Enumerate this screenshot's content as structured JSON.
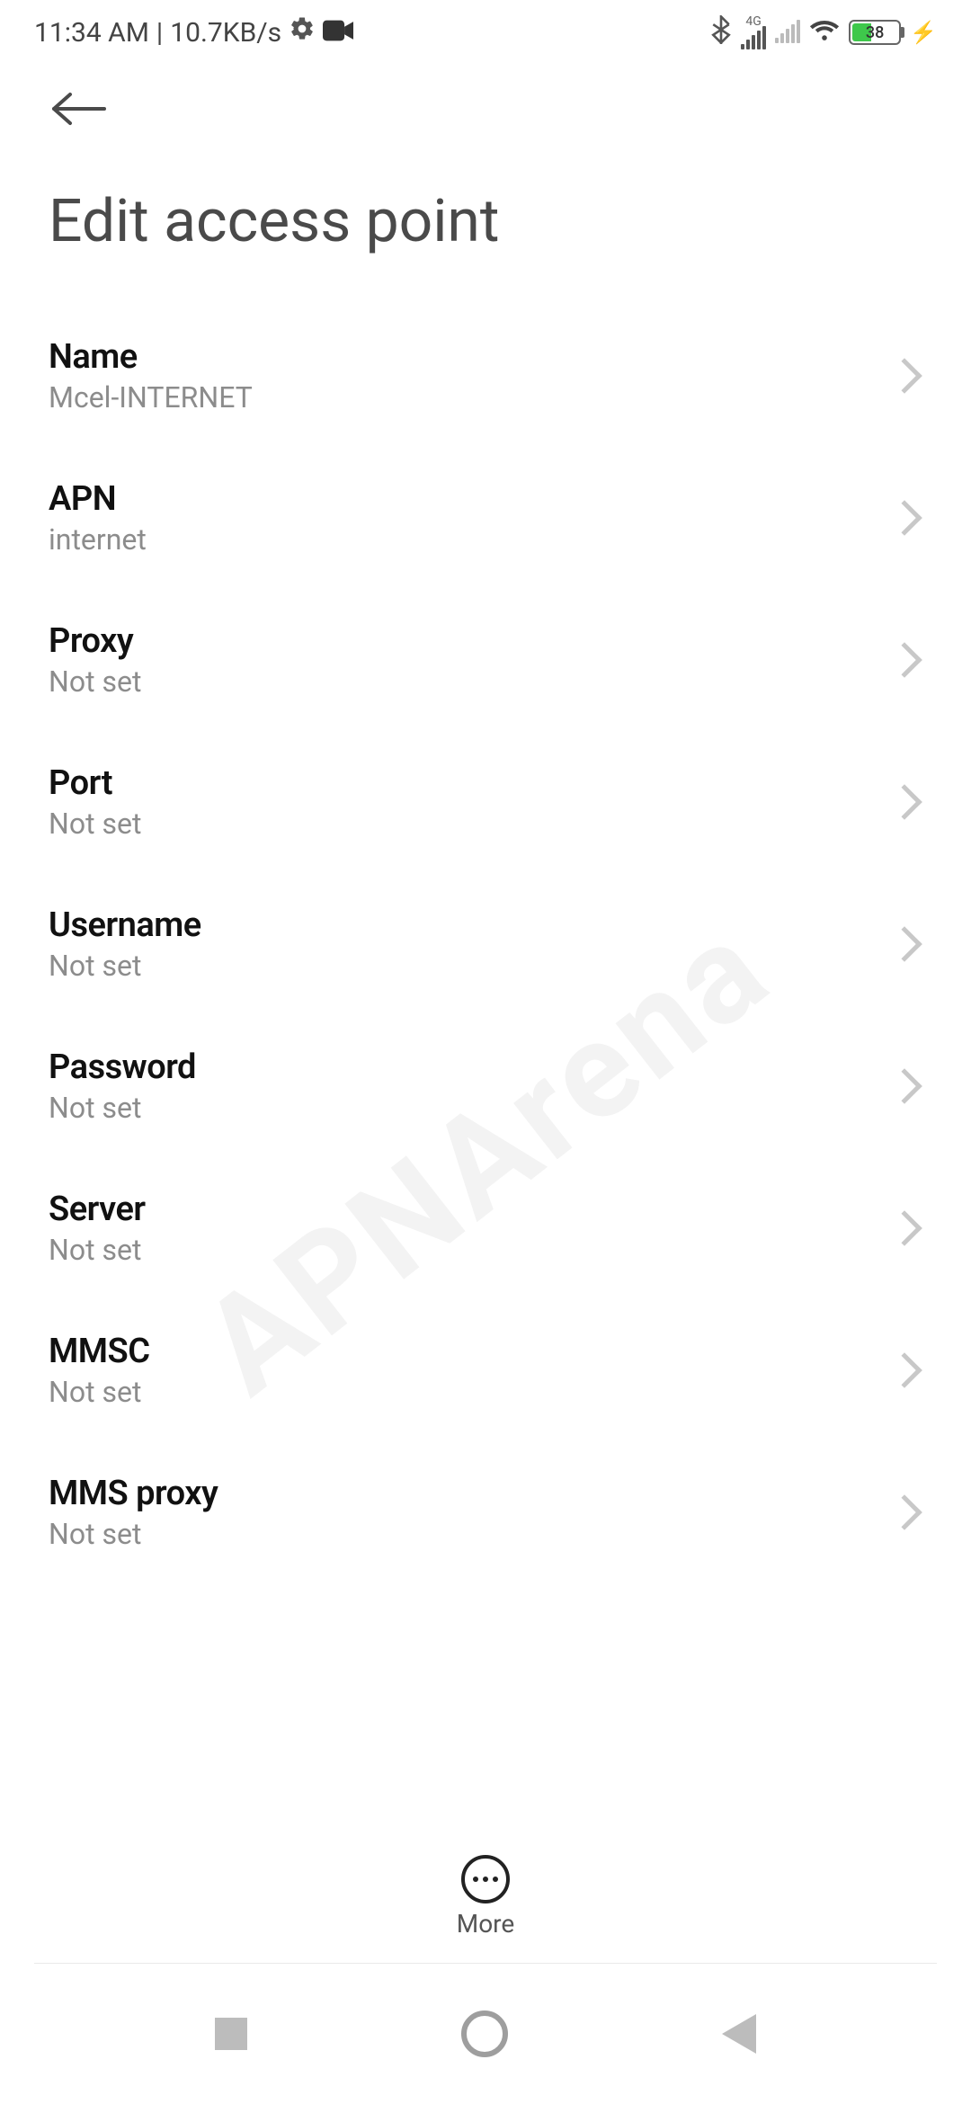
{
  "status": {
    "time": "11:34 AM",
    "data_rate": "10.7KB/s",
    "network_label": "4G",
    "battery_percent": "38"
  },
  "header": {
    "title": "Edit access point"
  },
  "items": [
    {
      "label": "Name",
      "value": "Mcel-INTERNET"
    },
    {
      "label": "APN",
      "value": "internet"
    },
    {
      "label": "Proxy",
      "value": "Not set"
    },
    {
      "label": "Port",
      "value": "Not set"
    },
    {
      "label": "Username",
      "value": "Not set"
    },
    {
      "label": "Password",
      "value": "Not set"
    },
    {
      "label": "Server",
      "value": "Not set"
    },
    {
      "label": "MMSC",
      "value": "Not set"
    },
    {
      "label": "MMS proxy",
      "value": "Not set"
    }
  ],
  "more": {
    "label": "More"
  },
  "watermark": "APNArena"
}
